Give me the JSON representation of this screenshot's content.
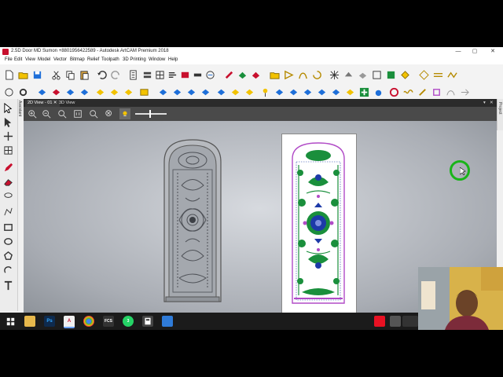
{
  "window": {
    "title": "2.5D Door MD Sumon +8801956422589 - Autodesk ArtCAM Premium 2018",
    "minimize_glyph": "—",
    "maximize_glyph": "▢",
    "close_glyph": "✕"
  },
  "menu": [
    "File",
    "Edit",
    "View",
    "Model",
    "Vector",
    "Bitmap",
    "Relief",
    "Toolpath",
    "3D Printing",
    "Window",
    "Help"
  ],
  "side_tabs": {
    "assistant": "Assistant",
    "project": "Project"
  },
  "view_tabs": [
    {
      "label": "2D View - 01",
      "active": true,
      "close": "✕"
    },
    {
      "label": "3D View",
      "active": false
    }
  ],
  "view_controls": {
    "pin": "▾",
    "close": "✕"
  },
  "taskbar": {
    "apps": [
      "start-icon",
      "file-explorer-icon",
      "photoshop-icon",
      "artcam-icon",
      "chrome-icon",
      "fcs-icon",
      "whatsapp-icon",
      "calculator-icon",
      "app-icon"
    ],
    "labels": {
      "photoshop": "Ps",
      "artcam": "A",
      "fcs": "FCS",
      "whatsapp": "3"
    }
  },
  "colors": {
    "title_accent": "#c8102e",
    "toolbar_blue": "#1e6fd9",
    "toolbar_yellow": "#f2c200",
    "cursor_ring": "#19b419",
    "design_green": "#1a8f3c",
    "design_purple": "#b14bc7",
    "design_blue": "#1d3aa8"
  }
}
